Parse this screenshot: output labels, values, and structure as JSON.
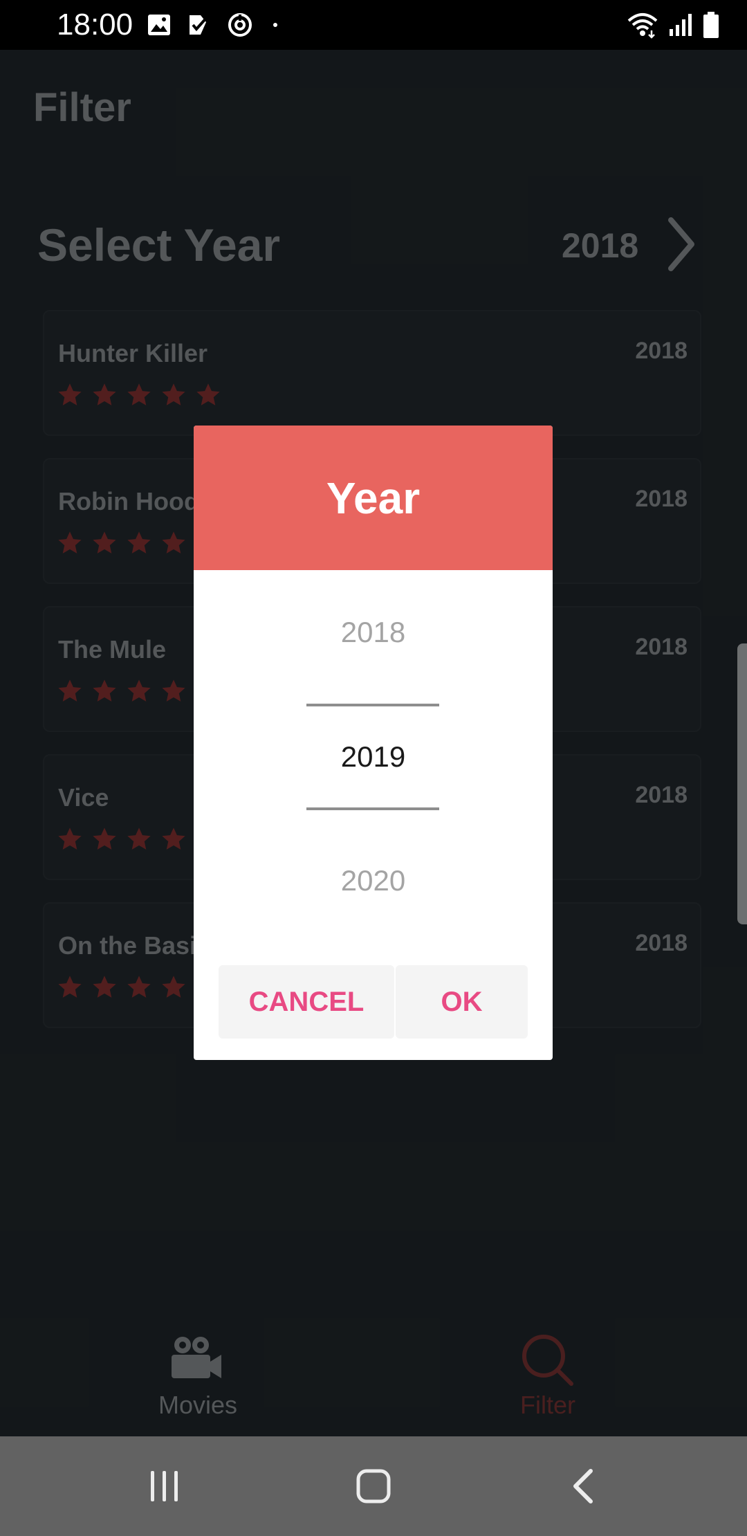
{
  "status_bar": {
    "time": "18:00",
    "left_icons": [
      "image-icon",
      "check-app-icon",
      "sync-app-icon",
      "dot-icon"
    ],
    "right_icons": [
      "wifi-icon",
      "signal-icon",
      "battery-icon"
    ]
  },
  "header": {
    "title": "Filter"
  },
  "filter": {
    "select_year_label": "Select Year",
    "selected_year": "2018"
  },
  "movies": [
    {
      "title": "Hunter Killer",
      "year": "2018",
      "rating": 5
    },
    {
      "title": "Robin Hood",
      "year": "2018",
      "rating": 5
    },
    {
      "title": "The Mule",
      "year": "2018",
      "rating": 5
    },
    {
      "title": "Vice",
      "year": "2018",
      "rating": 5
    },
    {
      "title": "On the Basis",
      "year": "2018",
      "rating": 5
    }
  ],
  "dialog": {
    "title": "Year",
    "picker": {
      "previous": "2018",
      "selected": "2019",
      "next": "2020"
    },
    "cancel_label": "CANCEL",
    "ok_label": "OK"
  },
  "bottom_nav": [
    {
      "label": "Movies",
      "icon": "movie-camera-icon",
      "active": false
    },
    {
      "label": "Filter",
      "icon": "search-icon",
      "active": true
    }
  ],
  "colors": {
    "accent": "#e8655f",
    "button_text": "#e84a83",
    "star": "#7a2d2d",
    "active_nav": "#6e2f2f",
    "inactive_nav": "#7d8184"
  }
}
